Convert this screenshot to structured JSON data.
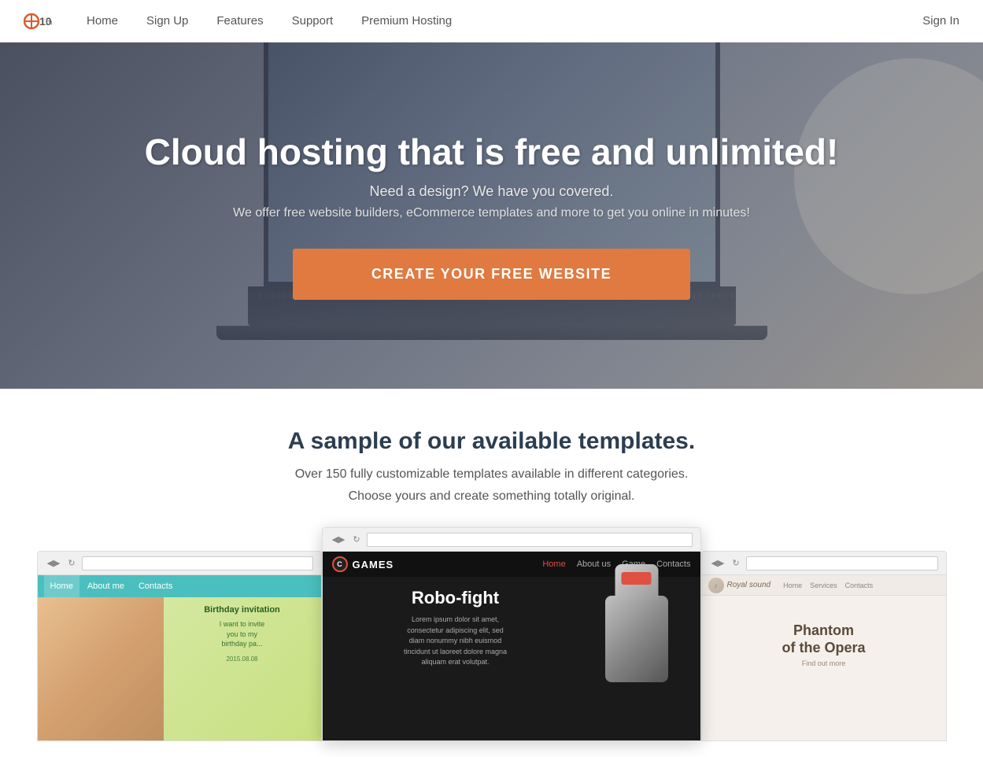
{
  "navbar": {
    "logo_text": "10hosting",
    "links": [
      {
        "label": "Home",
        "id": "home"
      },
      {
        "label": "Sign Up",
        "id": "signup"
      },
      {
        "label": "Features",
        "id": "features"
      },
      {
        "label": "Support",
        "id": "support"
      },
      {
        "label": "Premium Hosting",
        "id": "premium"
      }
    ],
    "signin_label": "Sign In"
  },
  "hero": {
    "title": "Cloud hosting that is free and unlimited!",
    "subtitle": "Need a design? We have you covered.",
    "description": "We offer free website builders, eCommerce templates and more to get you online in minutes!",
    "cta_label": "CREATE YOUR FREE WEBSITE"
  },
  "templates_section": {
    "title": "A sample of our available templates.",
    "desc1": "Over 150 fully customizable templates available in different categories.",
    "desc2": "Choose yours and create something totally original."
  },
  "template_previews": {
    "birthday": {
      "nav_items": [
        "Home",
        "About me",
        "Contacts"
      ],
      "heading": "Birthday invitation",
      "body": "I want to invite\nyou to my\nbirthday pa...",
      "date": "2015.08.08"
    },
    "games": {
      "logo": "C",
      "brand": "GAMES",
      "nav_items": [
        "Home",
        "About us",
        "Game",
        "Contacts"
      ],
      "title": "Robo-fight",
      "body": "Lorem ipsum dolor sit amet,\nconsectetur adipiscing elit, sed\ndiam nonummy nibh euismod\ntincidunt ut laoreet dolore magna\naliquam erat volutpat."
    },
    "royal": {
      "logo": "Royal sound",
      "nav_items": [
        "Home",
        "Services",
        "Contacts"
      ],
      "title": "Phantom\nof the Opera",
      "subtitle": "Find out more"
    }
  },
  "colors": {
    "nav_accent": "#e05a2b",
    "cta_orange": "#e07a40",
    "hero_dark": "#4a5060",
    "games_red": "#e05040",
    "teal": "#4bbfbf"
  }
}
